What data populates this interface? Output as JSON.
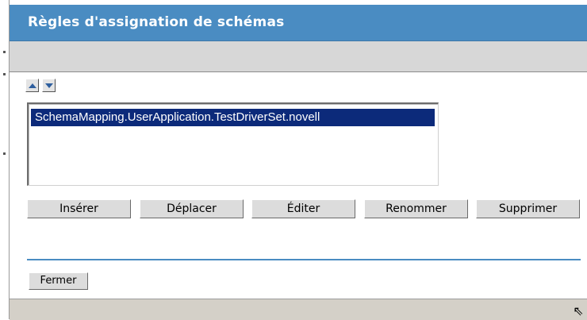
{
  "window": {
    "title": "Règles d'assignation de schémas"
  },
  "reorder": {
    "up_icon": "arrow-up-icon",
    "down_icon": "arrow-down-icon"
  },
  "rules_list": {
    "items": [
      "SchemaMapping.UserApplication.TestDriverSet.novell"
    ],
    "selected_index": 0
  },
  "actions": {
    "insert": "Insérer",
    "move": "Déplacer",
    "edit": "Éditer",
    "rename": "Renommer",
    "delete": "Supprimer"
  },
  "footer": {
    "close": "Fermer"
  },
  "status": {
    "grip_icon": "resize-grip-icon"
  },
  "colors": {
    "titlebar": "#4a8cc2",
    "selection": "#0c2a7a",
    "divider": "#4a8cc2"
  }
}
